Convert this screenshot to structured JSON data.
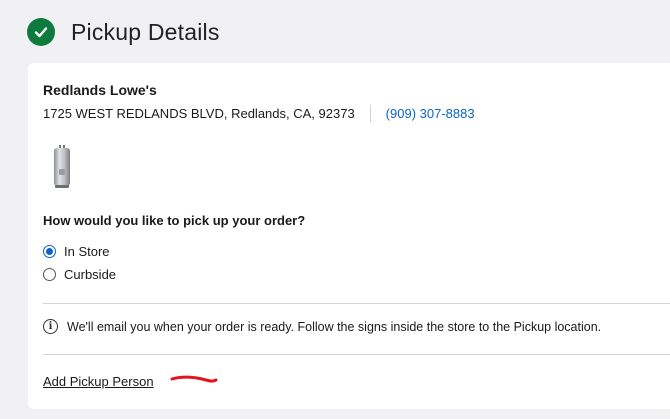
{
  "header": {
    "title": "Pickup Details",
    "check_color": "#0d7a3e"
  },
  "store": {
    "name": "Redlands Lowe's",
    "address": "1725 WEST REDLANDS BLVD, Redlands, CA, 92373",
    "phone": "(909) 307-8883"
  },
  "product": {
    "icon": "water-heater-image"
  },
  "pickup": {
    "question": "How would you like to pick up your order?",
    "options": [
      {
        "label": "In Store",
        "selected": true
      },
      {
        "label": "Curbside",
        "selected": false
      }
    ]
  },
  "info": {
    "icon": "info-icon",
    "message": "We'll email you when your order is ready. Follow the signs inside the store to the Pickup location."
  },
  "actions": {
    "add_pickup_person": "Add Pickup Person"
  },
  "colors": {
    "accent": "#0d63c6",
    "annotation": "#e0141e"
  }
}
